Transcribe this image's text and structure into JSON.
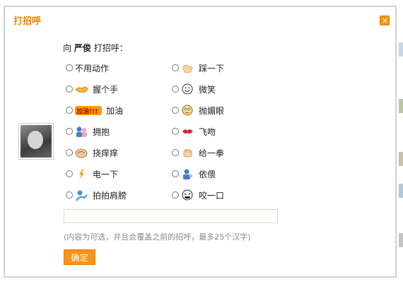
{
  "dialog": {
    "title": "打招呼",
    "intro_prefix": "向",
    "target_name": "严俊",
    "intro_suffix": "打招呼："
  },
  "options_left": [
    {
      "label": "不用动作",
      "icon": "none"
    },
    {
      "label": "握个手",
      "icon": "handshake-icon"
    },
    {
      "label": "加油",
      "icon": "cheer-icon"
    },
    {
      "label": "拥抱",
      "icon": "hug-icon"
    },
    {
      "label": "挠痒痒",
      "icon": "tickle-icon"
    },
    {
      "label": "电一下",
      "icon": "lightning-icon"
    },
    {
      "label": "拍拍肩膀",
      "icon": "pat-shoulder-icon"
    }
  ],
  "options_right": [
    {
      "label": "踩一下",
      "icon": "step-icon"
    },
    {
      "label": "微笑",
      "icon": "smile-icon"
    },
    {
      "label": "抛媚眼",
      "icon": "wink-icon"
    },
    {
      "label": "飞吻",
      "icon": "kiss-icon"
    },
    {
      "label": "给一拳",
      "icon": "punch-icon"
    },
    {
      "label": "依偎",
      "icon": "cuddle-icon"
    },
    {
      "label": "咬一口",
      "icon": "bite-icon"
    }
  ],
  "icons": {
    "cheer_text": "加油!!!"
  },
  "message": {
    "value": "",
    "placeholder": ""
  },
  "hint": "(内容为可选，并且会覆盖之前的招呼，最多25个汉字)",
  "confirm_label": "确定",
  "colors": {
    "accent": "#f7941d",
    "title": "#f08400"
  }
}
